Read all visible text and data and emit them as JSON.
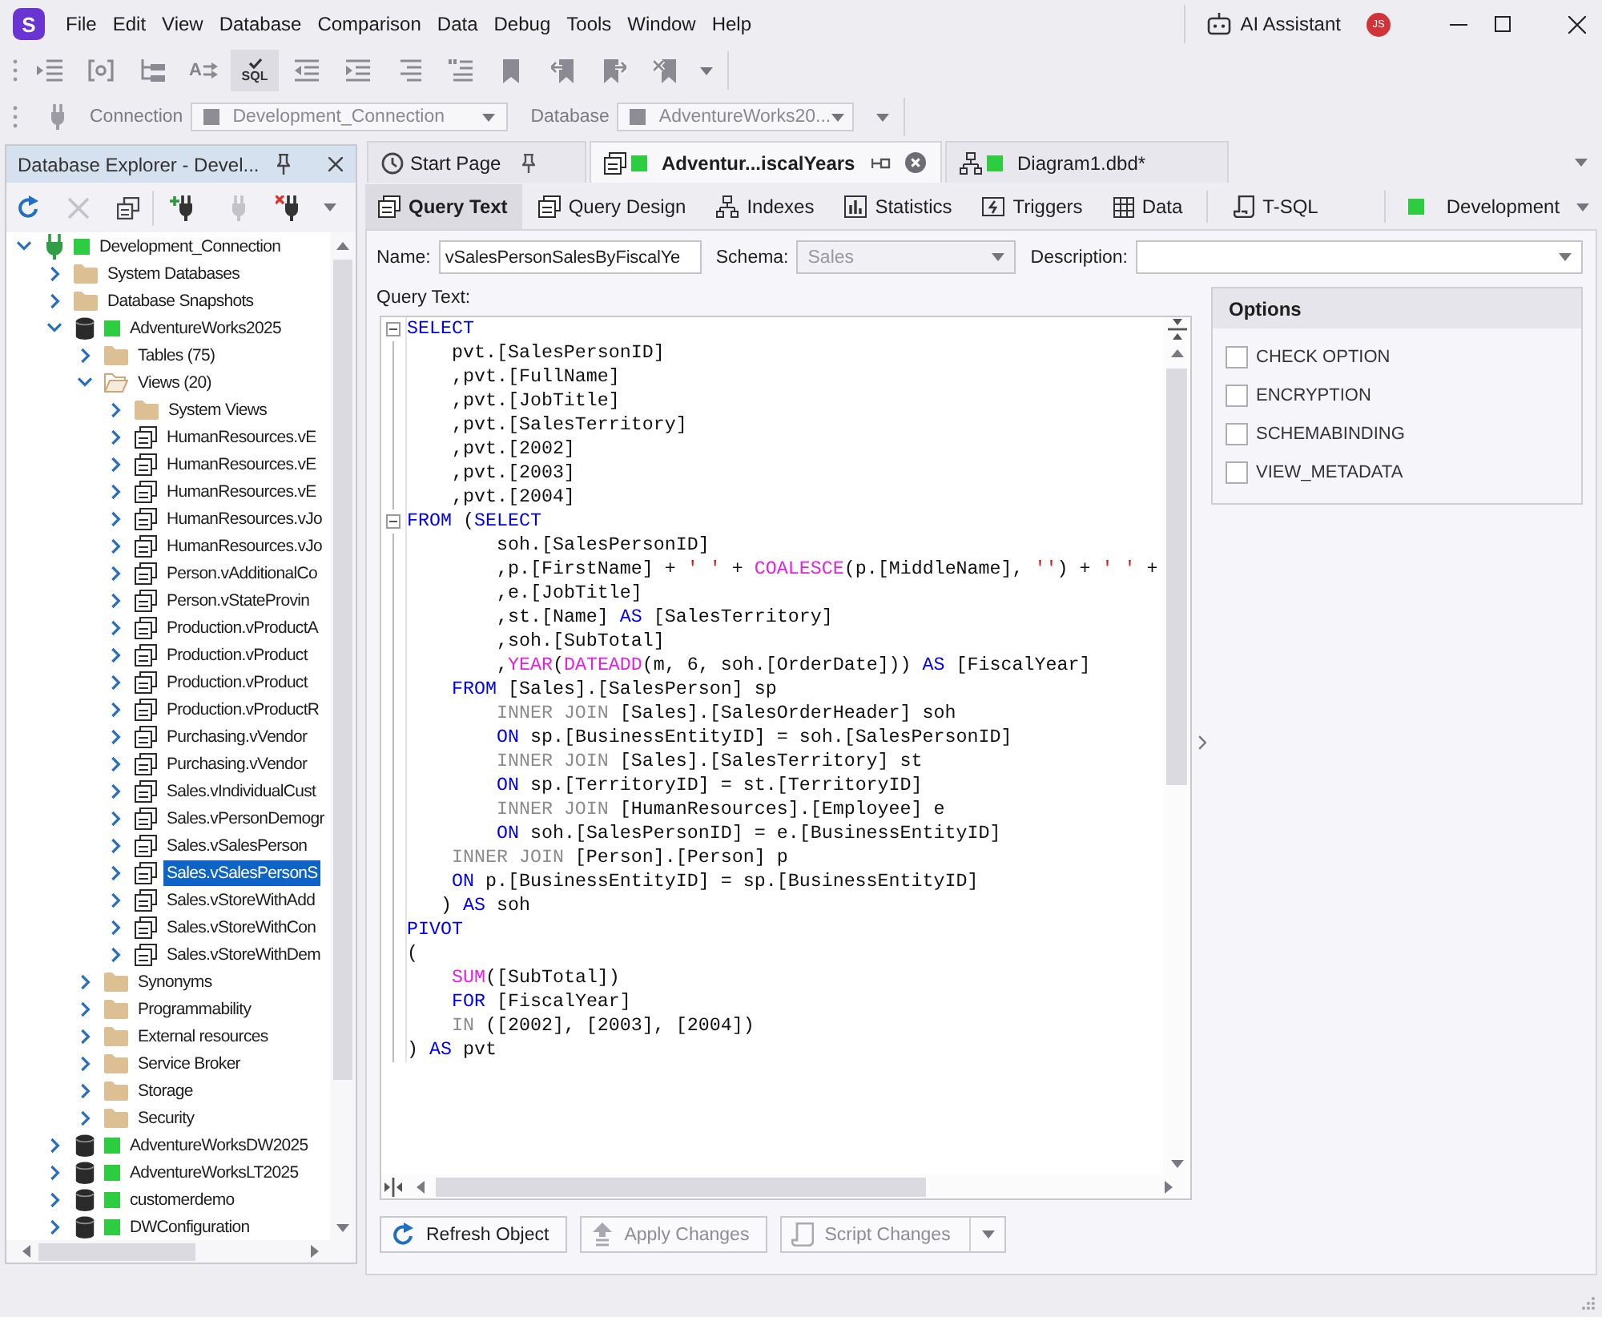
{
  "app": {
    "logo": "S",
    "menu": [
      "File",
      "Edit",
      "View",
      "Database",
      "Comparison",
      "Data",
      "Debug",
      "Tools",
      "Window",
      "Help"
    ],
    "assistant": "AI Assistant",
    "avatar": "JS"
  },
  "toolbar": [
    {
      "pressed": false
    },
    {
      "pressed": false
    },
    {
      "pressed": false
    },
    {
      "pressed": false,
      "label": "A"
    },
    {
      "pressed": true,
      "label": "SQL"
    },
    {
      "pressed": false
    },
    {
      "pressed": false
    },
    {
      "pressed": false
    },
    {
      "pressed": false
    },
    {
      "pressed": false
    },
    {
      "pressed": false
    },
    {
      "pressed": false
    },
    {
      "pressed": false
    }
  ],
  "connection_bar": {
    "connection_label": "Connection",
    "connection": "Development_Connection",
    "database_label": "Database",
    "database": "AdventureWorks20...",
    "disabled": true
  },
  "explorer": {
    "title": "Database Explorer - Devel...",
    "toolbar": [
      {
        "disabled": false
      },
      {
        "disabled": true
      },
      {
        "disabled": false
      },
      {
        "disabled": false
      },
      {
        "disabled": true
      },
      {
        "disabled": false
      }
    ],
    "tree": [
      {
        "kind": "connection",
        "label": "Development_Connection",
        "expanded": true,
        "selected": false,
        "children": [
          {
            "kind": "folder",
            "label": "System Databases",
            "expanded": false,
            "selected": false
          },
          {
            "kind": "folder",
            "label": "Database Snapshots",
            "expanded": false,
            "selected": false
          },
          {
            "kind": "database",
            "label": "AdventureWorks2025",
            "expanded": true,
            "selected": false,
            "children": [
              {
                "kind": "folder",
                "label": "Tables (75)",
                "expanded": false,
                "selected": false
              },
              {
                "kind": "folder",
                "label": "Views (20)",
                "expanded": true,
                "selected": false,
                "children": [
                  {
                    "kind": "folder",
                    "label": "System Views",
                    "expanded": false,
                    "selected": false
                  },
                  {
                    "kind": "view",
                    "label": "HumanResources.vE",
                    "expanded": false,
                    "selected": false
                  },
                  {
                    "kind": "view",
                    "label": "HumanResources.vE",
                    "expanded": false,
                    "selected": false
                  },
                  {
                    "kind": "view",
                    "label": "HumanResources.vE",
                    "expanded": false,
                    "selected": false
                  },
                  {
                    "kind": "view",
                    "label": "HumanResources.vJo",
                    "expanded": false,
                    "selected": false
                  },
                  {
                    "kind": "view",
                    "label": "HumanResources.vJo",
                    "expanded": false,
                    "selected": false
                  },
                  {
                    "kind": "view",
                    "label": "Person.vAdditionalCo",
                    "expanded": false,
                    "selected": false
                  },
                  {
                    "kind": "view",
                    "label": "Person.vStateProvin",
                    "expanded": false,
                    "selected": false
                  },
                  {
                    "kind": "view",
                    "label": "Production.vProductA",
                    "expanded": false,
                    "selected": false
                  },
                  {
                    "kind": "view",
                    "label": "Production.vProduct",
                    "expanded": false,
                    "selected": false
                  },
                  {
                    "kind": "view",
                    "label": "Production.vProduct",
                    "expanded": false,
                    "selected": false
                  },
                  {
                    "kind": "view",
                    "label": "Production.vProductR",
                    "expanded": false,
                    "selected": false
                  },
                  {
                    "kind": "view",
                    "label": "Purchasing.vVendor",
                    "expanded": false,
                    "selected": false
                  },
                  {
                    "kind": "view",
                    "label": "Purchasing.vVendor",
                    "expanded": false,
                    "selected": false
                  },
                  {
                    "kind": "view",
                    "label": "Sales.vIndividualCust",
                    "expanded": false,
                    "selected": false
                  },
                  {
                    "kind": "view",
                    "label": "Sales.vPersonDemogr",
                    "expanded": false,
                    "selected": false
                  },
                  {
                    "kind": "view",
                    "label": "Sales.vSalesPerson",
                    "expanded": false,
                    "selected": false
                  },
                  {
                    "kind": "view",
                    "label": "Sales.vSalesPersonS",
                    "expanded": false,
                    "selected": true
                  },
                  {
                    "kind": "view",
                    "label": "Sales.vStoreWithAdd",
                    "expanded": false,
                    "selected": false
                  },
                  {
                    "kind": "view",
                    "label": "Sales.vStoreWithCon",
                    "expanded": false,
                    "selected": false
                  },
                  {
                    "kind": "view",
                    "label": "Sales.vStoreWithDem",
                    "expanded": false,
                    "selected": false
                  }
                ]
              },
              {
                "kind": "folder",
                "label": "Synonyms",
                "expanded": false,
                "selected": false
              },
              {
                "kind": "folder",
                "label": "Programmability",
                "expanded": false,
                "selected": false
              },
              {
                "kind": "folder",
                "label": "External resources",
                "expanded": false,
                "selected": false
              },
              {
                "kind": "folder",
                "label": "Service Broker",
                "expanded": false,
                "selected": false
              },
              {
                "kind": "folder",
                "label": "Storage",
                "expanded": false,
                "selected": false
              },
              {
                "kind": "folder",
                "label": "Security",
                "expanded": false,
                "selected": false
              }
            ]
          },
          {
            "kind": "database",
            "label": "AdventureWorksDW2025",
            "expanded": false,
            "selected": false
          },
          {
            "kind": "database",
            "label": "AdventureWorksLT2025",
            "expanded": false,
            "selected": false
          },
          {
            "kind": "database",
            "label": "customerdemo",
            "expanded": false,
            "selected": false
          },
          {
            "kind": "database",
            "label": "DWConfiguration",
            "expanded": false,
            "selected": false
          }
        ]
      }
    ]
  },
  "documents": [
    {
      "kind": "start",
      "label": "Start Page",
      "selected": false,
      "pinned": false
    },
    {
      "kind": "view",
      "label": "Adventur...iscalYears",
      "selected": true,
      "pinned": true
    },
    {
      "kind": "diagram",
      "label": "Diagram1.dbd*",
      "selected": false
    }
  ],
  "editor_tabs": [
    {
      "label": "Query Text",
      "selected": true
    },
    {
      "label": "Query Design",
      "selected": false
    },
    {
      "label": "Indexes",
      "selected": false
    },
    {
      "label": "Statistics",
      "selected": false
    },
    {
      "label": "Triggers",
      "selected": false
    },
    {
      "label": "Data",
      "selected": false
    },
    {
      "label": "T-SQL",
      "selected": false
    }
  ],
  "environment": "Development",
  "form": {
    "name_label": "Name:",
    "name": "vSalesPersonSalesByFiscalYe",
    "schema_label": "Schema:",
    "schema": "Sales",
    "schema_disabled": true,
    "description_label": "Description:",
    "query_label": "Query Text:"
  },
  "editor": {
    "lines": [
      {
        "expanded": true,
        "tokens": [
          {
            "kind": "keyword",
            "text": "SELECT"
          }
        ]
      },
      {
        "tokens": [
          {
            "kind": "plain",
            "text": "    pvt.[SalesPersonID]"
          }
        ]
      },
      {
        "tokens": [
          {
            "kind": "plain",
            "text": "    ,pvt.[FullName]"
          }
        ]
      },
      {
        "tokens": [
          {
            "kind": "plain",
            "text": "    ,pvt.[JobTitle]"
          }
        ]
      },
      {
        "tokens": [
          {
            "kind": "plain",
            "text": "    ,pvt.[SalesTerritory]"
          }
        ]
      },
      {
        "tokens": [
          {
            "kind": "plain",
            "text": "    ,pvt.[2002]"
          }
        ]
      },
      {
        "tokens": [
          {
            "kind": "plain",
            "text": "    ,pvt.[2003]"
          }
        ]
      },
      {
        "tokens": [
          {
            "kind": "plain",
            "text": "    ,pvt.[2004]"
          }
        ]
      },
      {
        "expanded": true,
        "tokens": [
          {
            "kind": "keyword",
            "text": "FROM"
          },
          {
            "kind": "plain",
            "text": " ("
          },
          {
            "kind": "keyword",
            "text": "SELECT"
          }
        ]
      },
      {
        "tokens": [
          {
            "kind": "plain",
            "text": "        soh.[SalesPersonID]"
          }
        ]
      },
      {
        "tokens": [
          {
            "kind": "plain",
            "text": "        ,p.[FirstName] + "
          },
          {
            "kind": "string",
            "text": "' '"
          },
          {
            "kind": "plain",
            "text": " + "
          },
          {
            "kind": "function",
            "text": "COALESCE"
          },
          {
            "kind": "plain",
            "text": "(p.[MiddleName], "
          },
          {
            "kind": "string",
            "text": "''"
          },
          {
            "kind": "plain",
            "text": ") + "
          },
          {
            "kind": "string",
            "text": "' '"
          },
          {
            "kind": "plain",
            "text": " +"
          }
        ]
      },
      {
        "tokens": [
          {
            "kind": "plain",
            "text": "        ,e.[JobTitle]"
          }
        ]
      },
      {
        "tokens": [
          {
            "kind": "plain",
            "text": "        ,st.[Name] "
          },
          {
            "kind": "keyword",
            "text": "AS"
          },
          {
            "kind": "plain",
            "text": " [SalesTerritory]"
          }
        ]
      },
      {
        "tokens": [
          {
            "kind": "plain",
            "text": "        ,soh.[SubTotal]"
          }
        ]
      },
      {
        "tokens": [
          {
            "kind": "plain",
            "text": "        ,"
          },
          {
            "kind": "function",
            "text": "YEAR"
          },
          {
            "kind": "plain",
            "text": "("
          },
          {
            "kind": "function",
            "text": "DATEADD"
          },
          {
            "kind": "plain",
            "text": "(m, 6, soh.[OrderDate])) "
          },
          {
            "kind": "keyword",
            "text": "AS"
          },
          {
            "kind": "plain",
            "text": " [FiscalYear]"
          }
        ]
      },
      {
        "tokens": [
          {
            "kind": "keyword",
            "text": "    FROM"
          },
          {
            "kind": "plain",
            "text": " [Sales].[SalesPerson] sp"
          }
        ]
      },
      {
        "tokens": [
          {
            "kind": "operator",
            "text": "        INNER JOIN"
          },
          {
            "kind": "plain",
            "text": " [Sales].[SalesOrderHeader] soh"
          }
        ]
      },
      {
        "tokens": [
          {
            "kind": "keyword",
            "text": "        ON"
          },
          {
            "kind": "plain",
            "text": " sp.[BusinessEntityID] = soh.[SalesPersonID]"
          }
        ]
      },
      {
        "tokens": [
          {
            "kind": "operator",
            "text": "        INNER JOIN"
          },
          {
            "kind": "plain",
            "text": " [Sales].[SalesTerritory] st"
          }
        ]
      },
      {
        "tokens": [
          {
            "kind": "keyword",
            "text": "        ON"
          },
          {
            "kind": "plain",
            "text": " sp.[TerritoryID] = st.[TerritoryID]"
          }
        ]
      },
      {
        "tokens": [
          {
            "kind": "operator",
            "text": "        INNER JOIN"
          },
          {
            "kind": "plain",
            "text": " [HumanResources].[Employee] e"
          }
        ]
      },
      {
        "tokens": [
          {
            "kind": "keyword",
            "text": "        ON"
          },
          {
            "kind": "plain",
            "text": " soh.[SalesPersonID] = e.[BusinessEntityID]"
          }
        ]
      },
      {
        "tokens": [
          {
            "kind": "operator",
            "text": "    INNER JOIN"
          },
          {
            "kind": "plain",
            "text": " [Person].[Person] p"
          }
        ]
      },
      {
        "tokens": [
          {
            "kind": "keyword",
            "text": "    ON"
          },
          {
            "kind": "plain",
            "text": " p.[BusinessEntityID] = sp.[BusinessEntityID]"
          }
        ]
      },
      {
        "tokens": [
          {
            "kind": "plain",
            "text": "   ) "
          },
          {
            "kind": "keyword",
            "text": "AS"
          },
          {
            "kind": "plain",
            "text": " soh"
          }
        ]
      },
      {
        "tokens": [
          {
            "kind": "keyword",
            "text": "PIVOT"
          }
        ]
      },
      {
        "tokens": [
          {
            "kind": "plain",
            "text": "("
          }
        ]
      },
      {
        "tokens": [
          {
            "kind": "function",
            "text": "    SUM"
          },
          {
            "kind": "plain",
            "text": "([SubTotal])"
          }
        ]
      },
      {
        "tokens": [
          {
            "kind": "keyword",
            "text": "    FOR"
          },
          {
            "kind": "plain",
            "text": " [FiscalYear]"
          }
        ]
      },
      {
        "tokens": [
          {
            "kind": "operator",
            "text": "    IN"
          },
          {
            "kind": "plain",
            "text": " ([2002], [2003], [2004])"
          }
        ]
      },
      {
        "tokens": [
          {
            "kind": "plain",
            "text": ") "
          },
          {
            "kind": "keyword",
            "text": "AS"
          },
          {
            "kind": "plain",
            "text": " pvt"
          }
        ]
      }
    ]
  },
  "options": {
    "title": "Options",
    "items": [
      {
        "label": "CHECK OPTION",
        "checked": false
      },
      {
        "label": "ENCRYPTION",
        "checked": false
      },
      {
        "label": "SCHEMABINDING",
        "checked": false
      },
      {
        "label": "VIEW_METADATA",
        "checked": false
      }
    ]
  },
  "actions": [
    {
      "kind": "button",
      "label": "Refresh Object",
      "disabled": false
    },
    {
      "kind": "button",
      "label": "Apply Changes",
      "disabled": true
    },
    {
      "kind": "split",
      "label": "Script Changes",
      "disabled": true
    }
  ]
}
